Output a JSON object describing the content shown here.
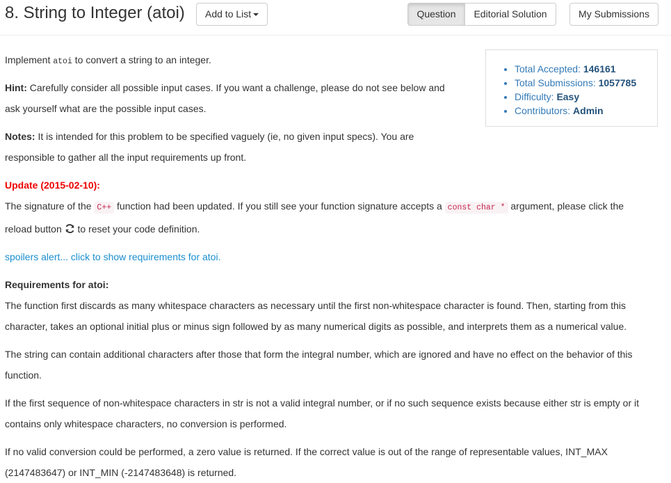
{
  "header": {
    "title": "8. String to Integer (atoi)",
    "add_to_list": "Add to List",
    "question_tab": "Question",
    "editorial_tab": "Editorial Solution",
    "submissions_button": "My Submissions"
  },
  "stats": {
    "accepted_label": "Total Accepted:",
    "accepted_value": "146161",
    "submissions_label": "Total Submissions:",
    "submissions_value": "1057785",
    "difficulty_label": "Difficulty:",
    "difficulty_value": "Easy",
    "contributors_label": "Contributors:",
    "contributors_value": "Admin"
  },
  "content": {
    "intro_before": "Implement ",
    "intro_code": "atoi",
    "intro_after": " to convert a string to an integer.",
    "hint_label": "Hint:",
    "hint_text": " Carefully consider all possible input cases. If you want a challenge, please do not see below and",
    "hint_text2": "ask yourself what are the possible input cases.",
    "notes_label": "Notes:",
    "notes_text": " It is intended for this problem to be specified vaguely (ie, no given input specs). You are",
    "notes_text2": "responsible to gather all the input requirements up front.",
    "update_label": "Update (2015-02-10):",
    "update_text1": "The signature of the ",
    "update_code1": "C++",
    "update_text2": " function had been updated. If you still see your function signature accepts a ",
    "update_code2": "const char *",
    "update_text3": " argument, please click the",
    "update_text4": "reload button ",
    "update_text5": " to reset your code definition.",
    "spoiler_link": "spoilers alert... click to show requirements for atoi.",
    "req_label": "Requirements for atoi:",
    "req_p1_l1": "The function first discards as many whitespace characters as necessary until the first non-whitespace character is found. Then, starting from this",
    "req_p1_l2": "character, takes an optional initial plus or minus sign followed by as many numerical digits as possible, and interprets them as a numerical value.",
    "req_p2_l1": "The string can contain additional characters after those that form the integral number, which are ignored and have no effect on the behavior of this",
    "req_p2_l2": "function.",
    "req_p3_l1": "If the first sequence of non-whitespace characters in str is not a valid integral number, or if no such sequence exists because either str is empty or it",
    "req_p3_l2": "contains only whitespace characters, no conversion is performed.",
    "req_p4_l1": "If no valid conversion could be performed, a zero value is returned. If the correct value is out of the range of representable values, INT_MAX",
    "req_p4_l2": "(2147483647) or INT_MIN (-2147483648) is returned."
  }
}
